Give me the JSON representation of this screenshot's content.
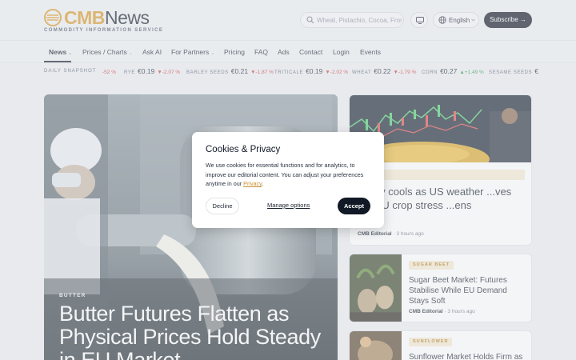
{
  "brand": {
    "name_part1": "CMB",
    "name_part2": "News",
    "tagline": "COMMODITY INFORMATION SERVICE",
    "accent_color": "#d99a2b"
  },
  "header": {
    "search_placeholder": "Wheat, Pistachio, Cocoa, Frost...",
    "language": "English",
    "subscribe_label": "Subscribe →"
  },
  "nav": {
    "items": [
      {
        "label": "News",
        "has_menu": true,
        "active": true
      },
      {
        "label": "Prices / Charts",
        "has_menu": true
      },
      {
        "label": "Ask AI"
      },
      {
        "label": "For Partners",
        "has_menu": true
      },
      {
        "label": "Pricing"
      },
      {
        "label": "FAQ"
      },
      {
        "label": "Ads"
      },
      {
        "label": "Contact"
      },
      {
        "label": "Login"
      },
      {
        "label": "Events"
      }
    ]
  },
  "ticker": {
    "label": "DAILY SNAPSHOT",
    "items": [
      {
        "name": "",
        "price": "",
        "change": "-52 %",
        "dir": "down"
      },
      {
        "name": "RYE",
        "price": "€0.19",
        "change": "▼-2.07 %",
        "dir": "down"
      },
      {
        "name": "BARLEY SEEDS",
        "price": "€0.21",
        "change": "▼-1.87 %",
        "dir": "down"
      },
      {
        "name": "TRITICALE",
        "price": "€0.19",
        "change": "▼-2.02 %",
        "dir": "down"
      },
      {
        "name": "WHEAT",
        "price": "€0.22",
        "change": "▼-1.79 %",
        "dir": "down"
      },
      {
        "name": "CORN",
        "price": "€0.27",
        "change": "▲+1.49 %",
        "dir": "up"
      },
      {
        "name": "SESAME SEEDS",
        "price": "€",
        "change": "",
        "dir": "up"
      }
    ]
  },
  "hero": {
    "tag": "BUTTER",
    "title": "Butter Futures Flatten as Physical Prices Hold Steady in EU Market"
  },
  "articles": {
    "top": {
      "title": "...rally cools as US weather ...ves but EU crop stress ...ens",
      "author": "CMB Editorial",
      "time": "3 hours ago"
    },
    "second": {
      "tag": "SUGAR BEET",
      "title": "Sugar Beet Market: Futures Stabilise While EU Demand Stays Soft",
      "author": "CMB Editorial",
      "time": "3 hours ago"
    },
    "third": {
      "tag": "SUNFLOWER",
      "title": "Sunflower Market Holds Firm as"
    }
  },
  "cookie_modal": {
    "title": "Cookies & Privacy",
    "body": "We use cookies for essential functions and for analytics, to improve our editorial content. You can adjust your preferences anytime in our",
    "privacy_link": "Privacy",
    "decline_label": "Decline",
    "options_label": "Manage options",
    "accept_label": "Accept"
  }
}
